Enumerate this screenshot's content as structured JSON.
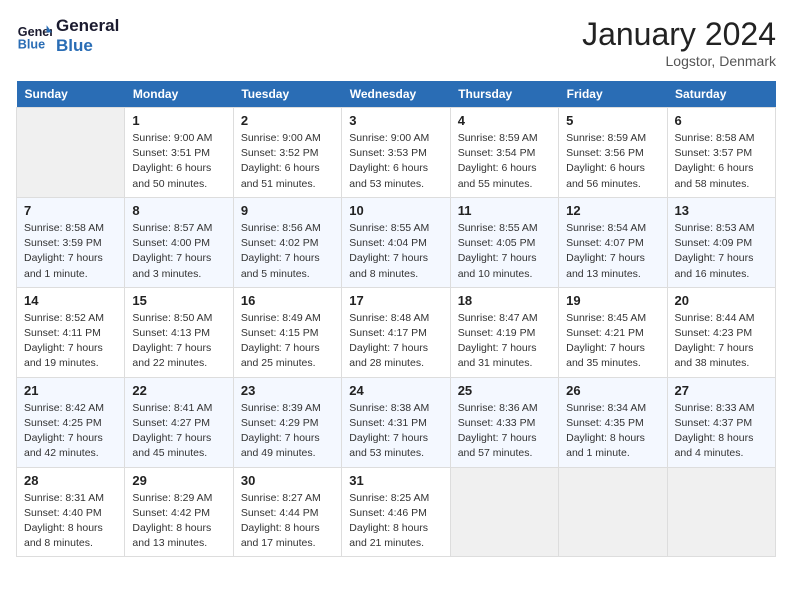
{
  "header": {
    "logo_line1": "General",
    "logo_line2": "Blue",
    "month": "January 2024",
    "location": "Logstor, Denmark"
  },
  "weekdays": [
    "Sunday",
    "Monday",
    "Tuesday",
    "Wednesday",
    "Thursday",
    "Friday",
    "Saturday"
  ],
  "weeks": [
    [
      {
        "day": "",
        "empty": true
      },
      {
        "day": "1",
        "sunrise": "9:00 AM",
        "sunset": "3:51 PM",
        "daylight": "6 hours and 50 minutes."
      },
      {
        "day": "2",
        "sunrise": "9:00 AM",
        "sunset": "3:52 PM",
        "daylight": "6 hours and 51 minutes."
      },
      {
        "day": "3",
        "sunrise": "9:00 AM",
        "sunset": "3:53 PM",
        "daylight": "6 hours and 53 minutes."
      },
      {
        "day": "4",
        "sunrise": "8:59 AM",
        "sunset": "3:54 PM",
        "daylight": "6 hours and 55 minutes."
      },
      {
        "day": "5",
        "sunrise": "8:59 AM",
        "sunset": "3:56 PM",
        "daylight": "6 hours and 56 minutes."
      },
      {
        "day": "6",
        "sunrise": "8:58 AM",
        "sunset": "3:57 PM",
        "daylight": "6 hours and 58 minutes."
      }
    ],
    [
      {
        "day": "7",
        "sunrise": "8:58 AM",
        "sunset": "3:59 PM",
        "daylight": "7 hours and 1 minute."
      },
      {
        "day": "8",
        "sunrise": "8:57 AM",
        "sunset": "4:00 PM",
        "daylight": "7 hours and 3 minutes."
      },
      {
        "day": "9",
        "sunrise": "8:56 AM",
        "sunset": "4:02 PM",
        "daylight": "7 hours and 5 minutes."
      },
      {
        "day": "10",
        "sunrise": "8:55 AM",
        "sunset": "4:04 PM",
        "daylight": "7 hours and 8 minutes."
      },
      {
        "day": "11",
        "sunrise": "8:55 AM",
        "sunset": "4:05 PM",
        "daylight": "7 hours and 10 minutes."
      },
      {
        "day": "12",
        "sunrise": "8:54 AM",
        "sunset": "4:07 PM",
        "daylight": "7 hours and 13 minutes."
      },
      {
        "day": "13",
        "sunrise": "8:53 AM",
        "sunset": "4:09 PM",
        "daylight": "7 hours and 16 minutes."
      }
    ],
    [
      {
        "day": "14",
        "sunrise": "8:52 AM",
        "sunset": "4:11 PM",
        "daylight": "7 hours and 19 minutes."
      },
      {
        "day": "15",
        "sunrise": "8:50 AM",
        "sunset": "4:13 PM",
        "daylight": "7 hours and 22 minutes."
      },
      {
        "day": "16",
        "sunrise": "8:49 AM",
        "sunset": "4:15 PM",
        "daylight": "7 hours and 25 minutes."
      },
      {
        "day": "17",
        "sunrise": "8:48 AM",
        "sunset": "4:17 PM",
        "daylight": "7 hours and 28 minutes."
      },
      {
        "day": "18",
        "sunrise": "8:47 AM",
        "sunset": "4:19 PM",
        "daylight": "7 hours and 31 minutes."
      },
      {
        "day": "19",
        "sunrise": "8:45 AM",
        "sunset": "4:21 PM",
        "daylight": "7 hours and 35 minutes."
      },
      {
        "day": "20",
        "sunrise": "8:44 AM",
        "sunset": "4:23 PM",
        "daylight": "7 hours and 38 minutes."
      }
    ],
    [
      {
        "day": "21",
        "sunrise": "8:42 AM",
        "sunset": "4:25 PM",
        "daylight": "7 hours and 42 minutes."
      },
      {
        "day": "22",
        "sunrise": "8:41 AM",
        "sunset": "4:27 PM",
        "daylight": "7 hours and 45 minutes."
      },
      {
        "day": "23",
        "sunrise": "8:39 AM",
        "sunset": "4:29 PM",
        "daylight": "7 hours and 49 minutes."
      },
      {
        "day": "24",
        "sunrise": "8:38 AM",
        "sunset": "4:31 PM",
        "daylight": "7 hours and 53 minutes."
      },
      {
        "day": "25",
        "sunrise": "8:36 AM",
        "sunset": "4:33 PM",
        "daylight": "7 hours and 57 minutes."
      },
      {
        "day": "26",
        "sunrise": "8:34 AM",
        "sunset": "4:35 PM",
        "daylight": "8 hours and 1 minute."
      },
      {
        "day": "27",
        "sunrise": "8:33 AM",
        "sunset": "4:37 PM",
        "daylight": "8 hours and 4 minutes."
      }
    ],
    [
      {
        "day": "28",
        "sunrise": "8:31 AM",
        "sunset": "4:40 PM",
        "daylight": "8 hours and 8 minutes."
      },
      {
        "day": "29",
        "sunrise": "8:29 AM",
        "sunset": "4:42 PM",
        "daylight": "8 hours and 13 minutes."
      },
      {
        "day": "30",
        "sunrise": "8:27 AM",
        "sunset": "4:44 PM",
        "daylight": "8 hours and 17 minutes."
      },
      {
        "day": "31",
        "sunrise": "8:25 AM",
        "sunset": "4:46 PM",
        "daylight": "8 hours and 21 minutes."
      },
      {
        "day": "",
        "empty": true
      },
      {
        "day": "",
        "empty": true
      },
      {
        "day": "",
        "empty": true
      }
    ]
  ]
}
